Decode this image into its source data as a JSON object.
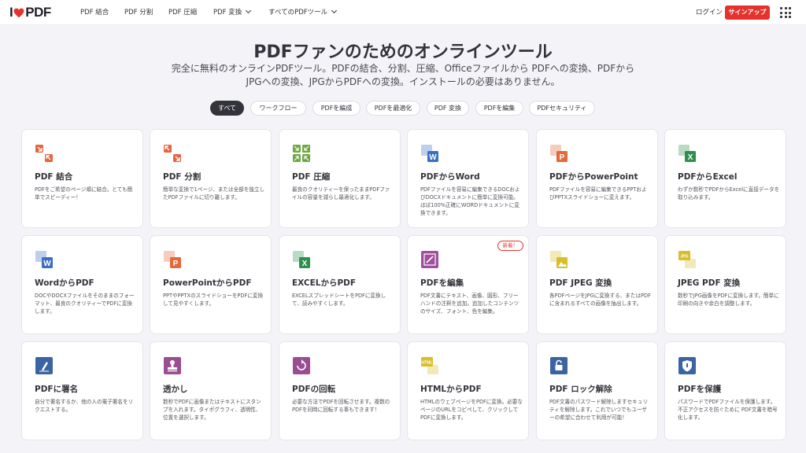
{
  "header": {
    "logo_left": "I",
    "logo_right": "PDF",
    "nav": [
      {
        "label": "PDF 結合",
        "dropdown": false
      },
      {
        "label": "PDF 分割",
        "dropdown": false
      },
      {
        "label": "PDF 圧縮",
        "dropdown": false
      },
      {
        "label": "PDF 変換",
        "dropdown": true
      },
      {
        "label": "すべてのPDFツール",
        "dropdown": true
      }
    ],
    "login": "ログイン",
    "signup": "サインアップ"
  },
  "hero": {
    "title": "PDFファンのためのオンラインツール",
    "subtitle": "完全に無料のオンラインPDFツール。PDFの結合、分割、圧縮、Officeファイルから PDFへの変換、PDFからJPGへの変換、JPGからPDFへの変換。インストールの必要はありません。"
  },
  "filters": [
    {
      "label": "すべて",
      "active": true
    },
    {
      "label": "ワークフロー",
      "active": false
    },
    {
      "label": "PDFを編成",
      "active": false
    },
    {
      "label": "PDFを最適化",
      "active": false
    },
    {
      "label": "PDF 変換",
      "active": false
    },
    {
      "label": "PDFを編集",
      "active": false
    },
    {
      "label": "PDFセキュリティ",
      "active": false
    }
  ],
  "tools": [
    {
      "title": "PDF 結合",
      "desc": "PDFをご希望のページ順に結合。とても簡単でスピーディー！",
      "icon": "merge-icon",
      "color": "#e5653e",
      "badge": ""
    },
    {
      "title": "PDF 分割",
      "desc": "簡単な変換で1ページ、または全部を独立したPDFファイルに切り離します。",
      "icon": "split-icon",
      "color": "#e5653e",
      "badge": ""
    },
    {
      "title": "PDF 圧縮",
      "desc": "最良のクオリティーを保ったままPDFファイルの容量を減らし最適化します。",
      "icon": "compress-icon",
      "color": "#6ea840",
      "badge": ""
    },
    {
      "title": "PDFからWord",
      "desc": "PDFファイルを容易に編集できるDOCおよびDOCXドキュメントに簡単に変換可能。ほぼ100%正確にWORDドキュメントに変換できます。",
      "icon": "word-icon",
      "color": "#3c6fc4",
      "badge": ""
    },
    {
      "title": "PDFからPowerPoint",
      "desc": "PDFファイルを容易に編集できるPPTおよびPPTXスライドショーに変えます。",
      "icon": "powerpoint-icon",
      "color": "#e26a3a",
      "badge": ""
    },
    {
      "title": "PDFからExcel",
      "desc": "わずか数秒でPDFからExcelに直接データを取り込みます。",
      "icon": "excel-icon",
      "color": "#2f8f4d",
      "badge": ""
    },
    {
      "title": "WordからPDF",
      "desc": "DOCやDOCXファイルをそのままのフォーマット、最良のクオリティーでPDFに変換します。",
      "icon": "word-icon",
      "color": "#3c6fc4",
      "badge": ""
    },
    {
      "title": "PowerPointからPDF",
      "desc": "PPTやPPTXのスライドショーをPDFに変換して見やすくします。",
      "icon": "powerpoint-icon",
      "color": "#e26a3a",
      "badge": ""
    },
    {
      "title": "EXCELからPDF",
      "desc": "EXCELスプレッドシートをPDFに変換して、読みやすくします。",
      "icon": "excel-icon",
      "color": "#2f8f4d",
      "badge": ""
    },
    {
      "title": "PDFを編集",
      "desc": "PDF文書にテキスト、画像、図形、フリーハンドの注釈を追加。追加したコンテンツのサイズ、フォント、色を編集。",
      "icon": "edit-icon",
      "color": "#a24f9b",
      "badge": "新着！"
    },
    {
      "title": "PDF JPEG 変換",
      "desc": "各PDFページをJPGに変換する、またはPDFに含まれるすべての画像を抽出します。",
      "icon": "pdf-to-jpg-icon",
      "color": "#d9bd2a",
      "badge": ""
    },
    {
      "title": "JPEG PDF 変換",
      "desc": "数秒でJPG画像をPDFに変換します。簡単に印刷の向きや余白を調整します。",
      "icon": "jpg-to-pdf-icon",
      "color": "#d9bd2a",
      "badge": ""
    },
    {
      "title": "PDFに署名",
      "desc": "自分で署名するか、他の人の電子署名をリクエストする。",
      "icon": "sign-icon",
      "color": "#3a64a3",
      "badge": ""
    },
    {
      "title": "透かし",
      "desc": "数秒でPDFに画像またはテキストにスタンプを入れます。タイポグラフィ、透明性、位置を選択します。",
      "icon": "watermark-icon",
      "color": "#9a4d91",
      "badge": ""
    },
    {
      "title": "PDFの回転",
      "desc": "必要な方法でPDFを回転させます。複数のPDFを同時に回転する事もできます！",
      "icon": "rotate-icon",
      "color": "#9a4d91",
      "badge": ""
    },
    {
      "title": "HTMLからPDF",
      "desc": "HTMLのウェブページをPDFに変換。必要なページのURLをコピペして、クリックしてPDFに変換します。",
      "icon": "html-icon",
      "color": "#d9bd2a",
      "badge": ""
    },
    {
      "title": "PDF ロック解除",
      "desc": "PDF文書のパスワード解除しますセキュリティを解除します。これでいつでもユーザーの希望に合わせて利用が可能！",
      "icon": "unlock-icon",
      "color": "#3a64a3",
      "badge": ""
    },
    {
      "title": "PDFを保護",
      "desc": "パスワードでPDFファイルを保護します。不正アクセスを防ぐために PDF文書を暗号化します。",
      "icon": "protect-icon",
      "color": "#3a64a3",
      "badge": ""
    }
  ],
  "labels": {
    "word": "W",
    "powerpoint": "P",
    "excel": "X",
    "jpg": "JPG",
    "html": "HTML"
  }
}
